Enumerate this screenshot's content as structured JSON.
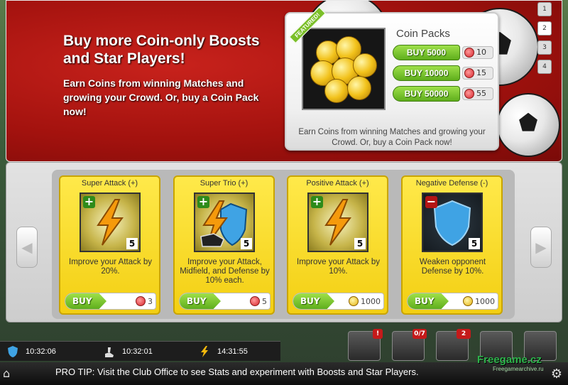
{
  "banner": {
    "headline": "Buy more Coin-only Boosts and Star Players!",
    "subtext": "Earn Coins from winning Matches and growing your Crowd. Or, buy a Coin Pack now!"
  },
  "coin_packs": {
    "featured_label": "FEATURED!",
    "title": "Coin Packs",
    "packs": [
      {
        "label": "BUY 5000",
        "cost": "10"
      },
      {
        "label": "BUY 10000",
        "cost": "15"
      },
      {
        "label": "BUY 50000",
        "cost": "55"
      }
    ],
    "note": "Earn Coins from winning Matches and growing your Crowd. Or, buy a Coin Pack now!"
  },
  "page_tabs": [
    "1",
    "2",
    "3",
    "4"
  ],
  "cards": [
    {
      "title": "Super Attack (+)",
      "level": "5",
      "desc": "Improve your Attack by 20%.",
      "buy": "BUY",
      "price": "3",
      "currency": "gem"
    },
    {
      "title": "Super Trio (+)",
      "level": "5",
      "desc": "Improve your Attack, Midfield, and Defense by 10% each.",
      "buy": "BUY",
      "price": "5",
      "currency": "gem"
    },
    {
      "title": "Positive Attack (+)",
      "level": "5",
      "desc": "Improve your Attack by 10%.",
      "buy": "BUY",
      "price": "1000",
      "currency": "coin"
    },
    {
      "title": "Negative Defense (-)",
      "level": "5",
      "desc": "Weaken opponent Defense by 10%.",
      "buy": "BUY",
      "price": "1000",
      "currency": "coin"
    }
  ],
  "timers": [
    {
      "icon": "shield-icon",
      "time": "10:32:06"
    },
    {
      "icon": "boot-icon",
      "time": "10:32:01"
    },
    {
      "icon": "lightning-icon",
      "time": "14:31:55"
    }
  ],
  "right_icons": {
    "trophy_badge": "0/7",
    "team_badge": "2"
  },
  "tip": "PRO TIP: Visit the Club Office to see Stats and experiment with Boosts and Star Players.",
  "watermark": "Freegame.cz",
  "watermark_sub": "Freegamearchive.ru"
}
